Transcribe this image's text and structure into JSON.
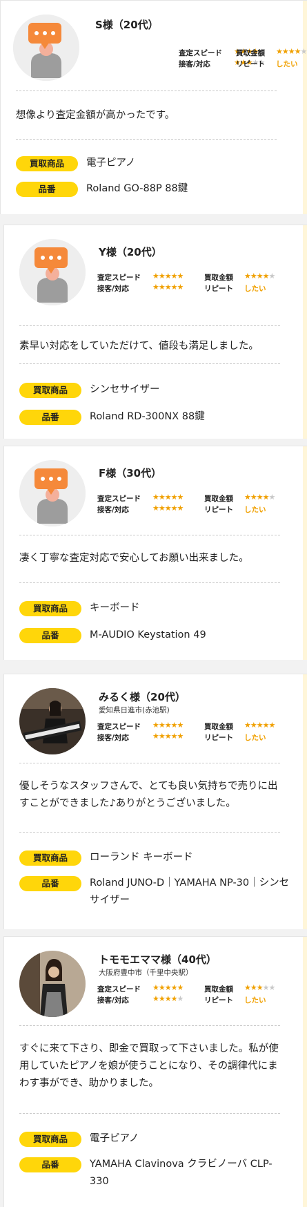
{
  "colors": {
    "badge": "#ffd60a",
    "star": "#f0a000",
    "star_empty": "#c8c8c8",
    "avatar_bubble": "#f5893a"
  },
  "rating_labels": {
    "speed": "査定スピード",
    "price": "買取金額",
    "service": "接客/対応",
    "repeat": "リピート"
  },
  "badge_labels": {
    "item": "買取商品",
    "model": "品番"
  },
  "reviews": [
    {
      "name": "S様（20代）",
      "location": "",
      "avatar": "speech-bubble-avatar-icon",
      "speed_stars": "★★★★★",
      "ratings": {
        "speed": 4,
        "price": 4,
        "service": 3
      },
      "repeat": "したい",
      "comment": "想像より査定金額が高かったです。",
      "item": "電子ピアノ",
      "model": "Roland GO-88P 88鍵"
    },
    {
      "name": "Y様（20代）",
      "location": "",
      "avatar": "speech-bubble-avatar-icon",
      "ratings": {
        "speed": 5,
        "price": 4,
        "service": 5
      },
      "repeat": "したい",
      "comment": "素早い対応をしていただけて、値段も満足しました。",
      "item": "シンセサイザー",
      "model": "Roland RD-300NX 88鍵"
    },
    {
      "name": "F様（30代）",
      "location": "",
      "avatar": "speech-bubble-avatar-icon",
      "ratings": {
        "speed": 5,
        "price": 4,
        "service": 5
      },
      "repeat": "したい",
      "comment": "凄く丁寧な査定対応で安心してお願い出来ました。",
      "item": "キーボード",
      "model": "M-AUDIO Keystation 49"
    },
    {
      "name": "みるく様（20代）",
      "location": "愛知県日進市(赤池駅)",
      "avatar": "customer-photo-with-keyboard",
      "ratings": {
        "speed": 5,
        "price": 5,
        "service": 5
      },
      "repeat": "したい",
      "comment": "優しそうなスタッフさんで、とても良い気持ちで売りに出すことができました♪ありがとうございました。",
      "item": "ローランド キーボード",
      "model": "Roland JUNO-D｜YAMAHA NP-30｜シンセサイザー"
    },
    {
      "name": "トモモエママ様（40代）",
      "location": "大阪府豊中市（千里中央駅）",
      "avatar": "customer-photo-portrait",
      "ratings": {
        "speed": 5,
        "price": 3,
        "service": 4
      },
      "repeat": "したい",
      "comment": "すぐに来て下さり、即金で買取って下さいました。私が使用していたピアノを娘が使うことになり、その調律代にまわす事ができ、助かりました。",
      "item": "電子ピアノ",
      "model": "YAMAHA Clavinova クラビノーバ CLP-330"
    }
  ]
}
